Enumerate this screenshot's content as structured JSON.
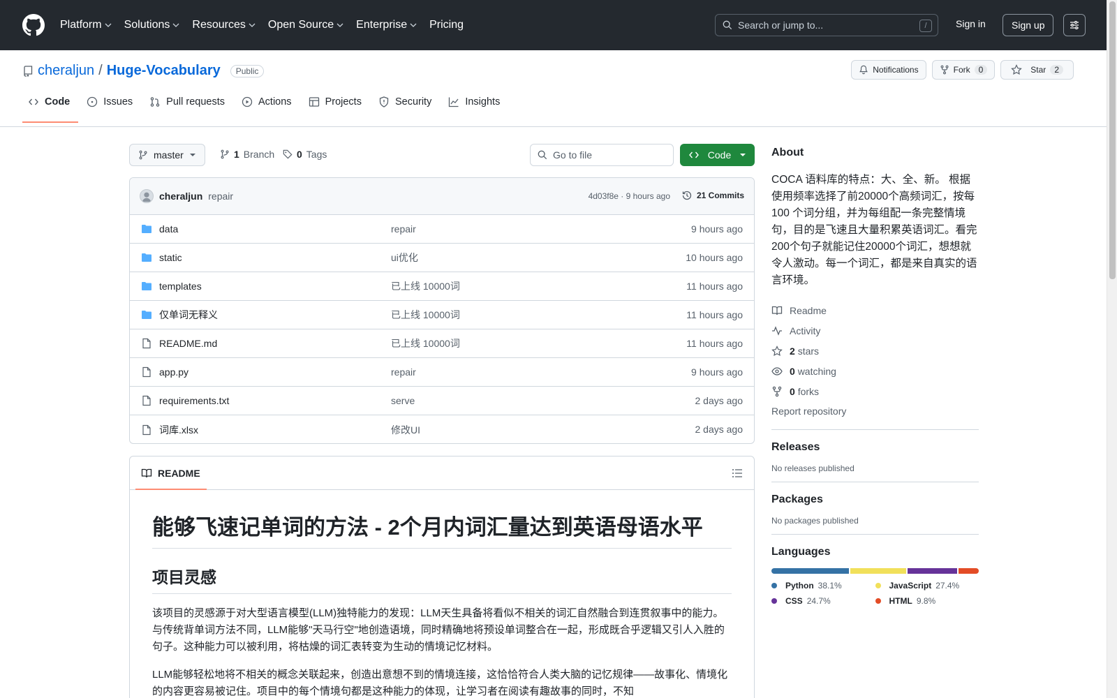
{
  "header": {
    "nav": [
      "Platform",
      "Solutions",
      "Resources",
      "Open Source",
      "Enterprise",
      "Pricing"
    ],
    "search_placeholder": "Search or jump to...",
    "search_key": "/",
    "signin": "Sign in",
    "signup": "Sign up"
  },
  "repo": {
    "owner": "cheraljun",
    "sep": "/",
    "name": "Huge-Vocabulary",
    "visibility": "Public",
    "notifications": "Notifications",
    "fork_label": "Fork",
    "fork_count": "0",
    "star_label": "Star",
    "star_count": "2",
    "tabs": [
      "Code",
      "Issues",
      "Pull requests",
      "Actions",
      "Projects",
      "Security",
      "Insights"
    ]
  },
  "branch": {
    "name": "master",
    "branch_count": "1",
    "branch_label": "Branch",
    "tag_count": "0",
    "tag_label": "Tags",
    "goto_placeholder": "Go to file",
    "code_label": "Code"
  },
  "commit": {
    "author": "cheraljun",
    "message": "repair",
    "meta": "4d03f8e · 9 hours ago",
    "commits": "21 Commits"
  },
  "files": [
    {
      "type": "dir",
      "name": "data",
      "message": "repair",
      "time": "9 hours ago"
    },
    {
      "type": "dir",
      "name": "static",
      "message": "ui优化",
      "time": "10 hours ago"
    },
    {
      "type": "dir",
      "name": "templates",
      "message": "已上线 10000词",
      "time": "11 hours ago"
    },
    {
      "type": "dir",
      "name": "仅单词无释义",
      "message": "已上线 10000词",
      "time": "11 hours ago"
    },
    {
      "type": "file",
      "name": "README.md",
      "message": "已上线 10000词",
      "time": "11 hours ago"
    },
    {
      "type": "file",
      "name": "app.py",
      "message": "repair",
      "time": "9 hours ago"
    },
    {
      "type": "file",
      "name": "requirements.txt",
      "message": "serve",
      "time": "2 days ago"
    },
    {
      "type": "file",
      "name": "词库.xlsx",
      "message": "修改UI",
      "time": "2 days ago"
    }
  ],
  "readme": {
    "tab": "README",
    "h1": "能够飞速记单词的方法 - 2个月内词汇量达到英语母语水平",
    "h2": "项目灵感",
    "p1": "该项目的灵感源于对大型语言模型(LLM)独特能力的发现：LLM天生具备将看似不相关的词汇自然融合到连贯叙事中的能力。与传统背单词方法不同，LLM能够\"天马行空\"地创造语境，同时精确地将预设单词整合在一起，形成既合乎逻辑又引人入胜的句子。这种能力可以被利用，将枯燥的词汇表转变为生动的情境记忆材料。",
    "p2": "LLM能够轻松地将不相关的概念关联起来，创造出意想不到的情境连接，这恰恰符合人类大脑的记忆规律——故事化、情境化的内容更容易被记住。项目中的每个情境句都是这种能力的体现，让学习者在阅读有趣故事的同时，不知"
  },
  "sidebar": {
    "about": "About",
    "description": "COCA 语料库的特点：大、全、新。 根据使用频率选择了前20000个高频词汇，按每 100 个词分组，并为每组配一条完整情境句，目的是飞速且大量积累英语词汇。看完200个句子就能记住20000个词汇，想想就令人激动。每一个词汇，都是来自真实的语言环境。",
    "readme": "Readme",
    "activity": "Activity",
    "stars_num": "2",
    "stars_label": "stars",
    "watching_num": "0",
    "watching_label": "watching",
    "forks_num": "0",
    "forks_label": "forks",
    "report": "Report repository",
    "releases": "Releases",
    "releases_empty": "No releases published",
    "packages": "Packages",
    "packages_empty": "No packages published",
    "languages": "Languages",
    "langs": [
      {
        "name": "Python",
        "percent": "38.1%",
        "value": 38.1,
        "color": "#3572A5"
      },
      {
        "name": "JavaScript",
        "percent": "27.4%",
        "value": 27.4,
        "color": "#f1e05a"
      },
      {
        "name": "CSS",
        "percent": "24.7%",
        "value": 24.7,
        "color": "#663399"
      },
      {
        "name": "HTML",
        "percent": "9.8%",
        "value": 9.8,
        "color": "#e34c26"
      }
    ]
  }
}
